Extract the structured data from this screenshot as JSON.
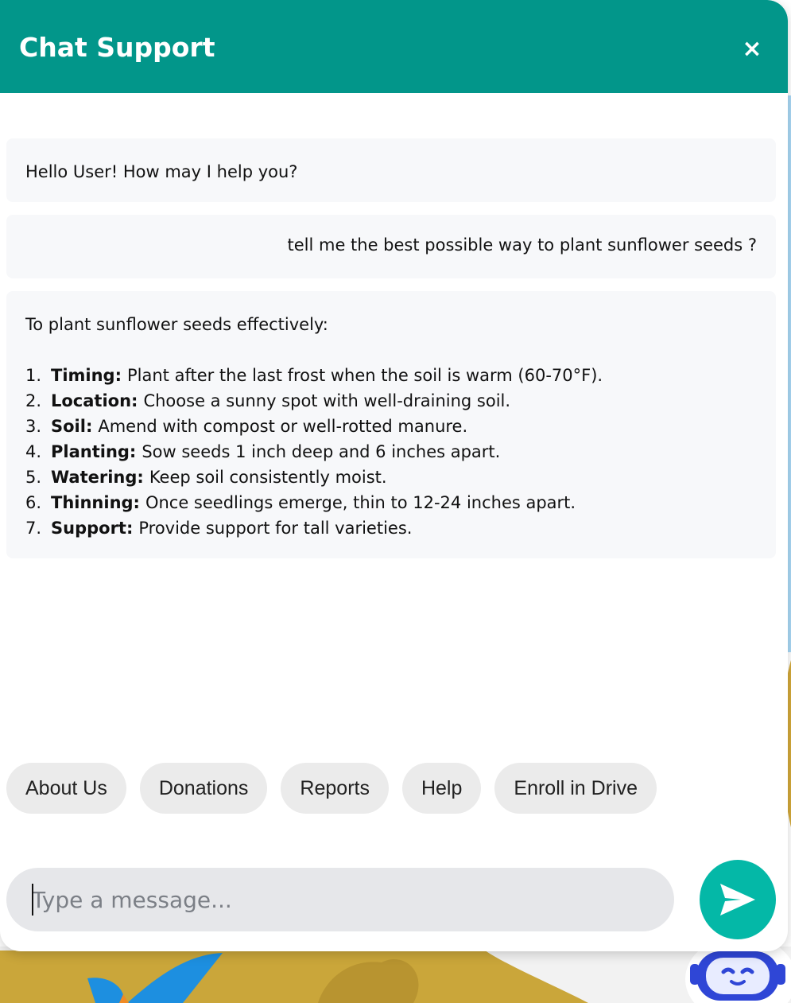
{
  "header": {
    "title": "Chat Support",
    "close_label": "×"
  },
  "messages": {
    "greeting": "Hello User! How may I help you?",
    "user_question": "tell me the best possible way to plant sunflower seeds ?",
    "answer": {
      "intro": "To plant sunflower seeds effectively:",
      "steps": [
        {
          "num": "1.",
          "term": "Timing:",
          "text": "Plant after the last frost when the soil is warm (60-70°F)."
        },
        {
          "num": "2.",
          "term": "Location:",
          "text": "Choose a sunny spot with well-draining soil."
        },
        {
          "num": "3.",
          "term": "Soil:",
          "text": "Amend with compost or well-rotted manure."
        },
        {
          "num": "4.",
          "term": "Planting:",
          "text": "Sow seeds 1 inch deep and 6 inches apart."
        },
        {
          "num": "5.",
          "term": "Watering:",
          "text": "Keep soil consistently moist."
        },
        {
          "num": "6.",
          "term": "Thinning:",
          "text": "Once seedlings emerge, thin to 12-24 inches apart."
        },
        {
          "num": "7.",
          "term": "Support:",
          "text": "Provide support for tall varieties."
        }
      ]
    }
  },
  "quick_replies": [
    "About Us",
    "Donations",
    "Reports",
    "Help",
    "Enroll in Drive"
  ],
  "input": {
    "placeholder": "Type a message...",
    "value": ""
  },
  "icons": {
    "send": "send-arrow-icon",
    "close": "close-icon",
    "bot": "robot-icon"
  },
  "colors": {
    "header": "#02968a",
    "send_button": "#04b8a7",
    "bot_blue": "#2f46d6"
  }
}
